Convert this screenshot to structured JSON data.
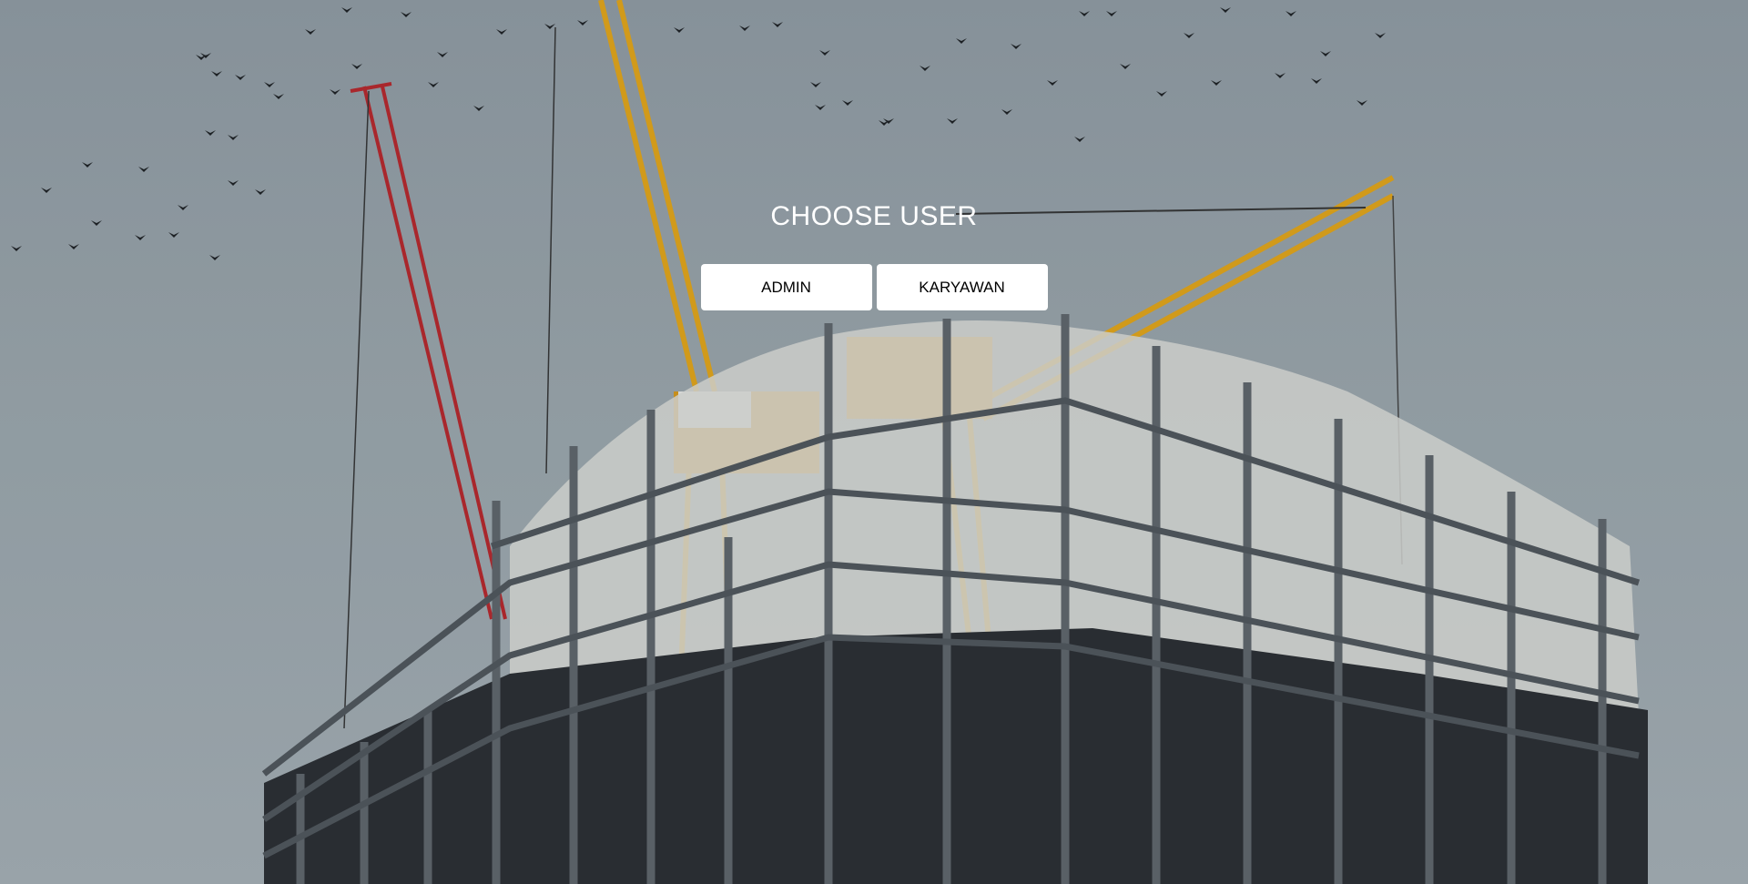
{
  "page": {
    "title": "CHOOSE USER",
    "background_image": "construction-site-cranes-birds-photo"
  },
  "buttons": {
    "admin_label": "ADMIN",
    "karyawan_label": "KARYAWAN"
  },
  "colors": {
    "sky": "#99a4aa",
    "crane_yellow": "#e0a318",
    "crane_red": "#b5262b",
    "button_bg": "#ffffff",
    "title_text": "#ffffff"
  }
}
